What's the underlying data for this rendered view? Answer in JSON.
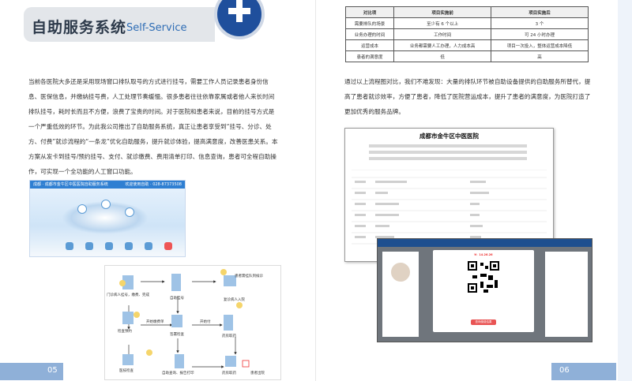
{
  "left_page": {
    "header": {
      "title": "自助服务系统",
      "subtitle": "Self-Service"
    },
    "paragraph": "当前各医院大多还是采用现场窗口排队取号的方式进行挂号，需要工作人员记录患者身份信息、医保信息，并缴纳挂号费，人工处理节奏缓慢。很多患者往往依靠家属或者他人来长时间排队挂号，耗时长而且不方便，浪费了宝贵的时间。对于医院和患者来说，目前的挂号方式是一个严重低效的环节。为此我公司推出了自助服务系统，真正让患者享受到“挂号、分诊、处方、付费”就诊流程的“一条龙”优化自助服务，提升就诊体验，提高满意度，改善医患关系。本方案从发卡到挂号/预约挂号、支付、就诊缴费、费用清单打印、信息查询，患者可全程自助操作，可实现一个全功能的人工窗口功能。",
    "screenshot_title": "成都 · 成都市金牛区中医医院自助服务系统",
    "screenshot_right": "欢迎使用自助 · 028-87373508",
    "flow": {
      "nodes": [
        "门诊病人挂号，缴费、完成",
        "自助挂号",
        "患者需挂队到候诊",
        "复诊病人入院",
        "检查预约",
        "开始缴费单",
        "签署检查",
        "药房取药",
        "医技检查",
        "自助查询、报告打印",
        "药房取药",
        "患者出院"
      ],
      "edge_labels": [
        "开始缴费单",
        "开始付"
      ]
    },
    "page_number": "05"
  },
  "right_page": {
    "table": {
      "headers": [
        "对比项",
        "项目实施前",
        "项目实施后"
      ],
      "rows": [
        [
          "需要排队的场景",
          "至少有 6 个以上",
          "3 个"
        ],
        [
          "业务办理的时间",
          "工作时间",
          "可 24 小时办理"
        ],
        [
          "运营成本",
          "业务都需要人工办理，人力成本高",
          "项目一次投入，整体运营成本降低"
        ],
        [
          "患者的满意度",
          "低",
          "高"
        ]
      ]
    },
    "paragraph": "通过以上流程图对比，我们不难发现：大量的排队环节被自助设备提供的自助服务所替代，提高了患者就诊效率，方便了患者，降低了医院营运成本，提升了患者的满意度，为医院打造了更加优秀的服务品牌。",
    "system_screenshot": {
      "hospital_title": "成都市金牛区中医医院",
      "payment_amount": "¥：14.26.26",
      "button_label": "查询缴费结果"
    },
    "page_number": "06"
  },
  "colors": {
    "accent": "#1f4f9c",
    "footer": "#8fb0d8",
    "banner": "#e3e6ea"
  }
}
